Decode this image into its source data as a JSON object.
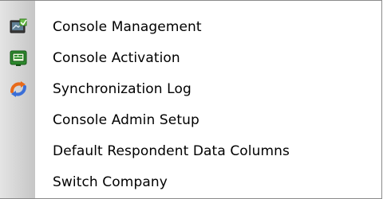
{
  "menu": {
    "items": [
      {
        "label": "Console Management",
        "icon": "console-management-icon"
      },
      {
        "label": "Console Activation",
        "icon": "console-activation-icon"
      },
      {
        "label": "Synchronization Log",
        "icon": "sync-log-icon"
      },
      {
        "label": "Console Admin Setup",
        "icon": ""
      },
      {
        "label": "Default Respondent Data Columns",
        "icon": ""
      },
      {
        "label": "Switch Company",
        "icon": ""
      }
    ]
  },
  "colors": {
    "icon_strip": "#cfcfcf",
    "border": "#8a8a8a",
    "text": "#000000"
  }
}
